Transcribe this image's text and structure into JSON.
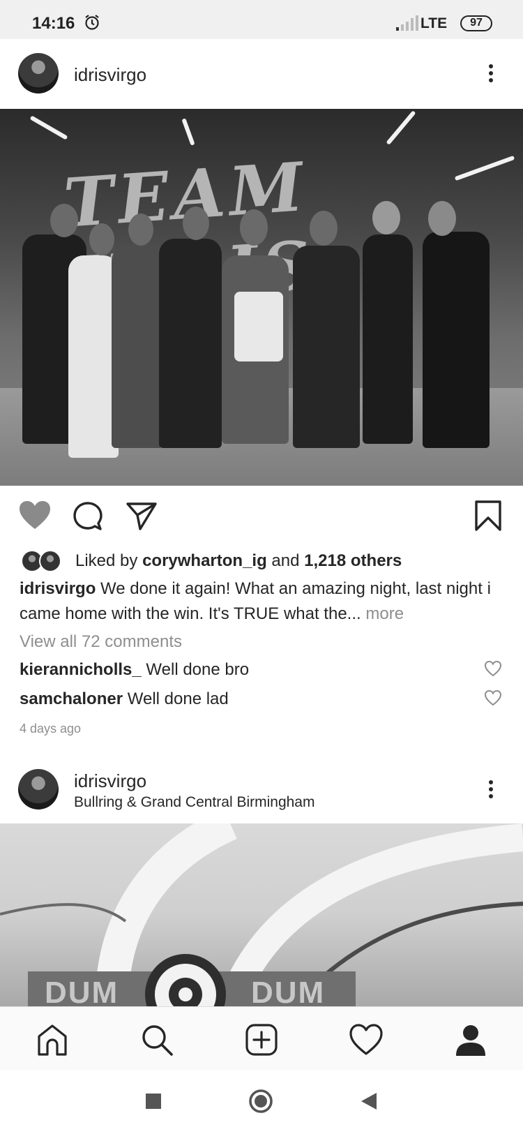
{
  "status_bar": {
    "time": "14:16",
    "network": "LTE",
    "battery": "97",
    "icons": [
      "alarm-icon",
      "signal-icon"
    ]
  },
  "post1": {
    "username": "idrisvirgo",
    "photo_text": "TEAM IDRIS",
    "liked_by_prefix": "Liked by ",
    "liked_by_user": "corywharton_ig",
    "liked_by_middle": " and ",
    "liked_by_count": "1,218 others",
    "caption_user": "idrisvirgo",
    "caption_text": " We done it again! What an amazing night, last night i came home with the win. It's TRUE what the",
    "caption_ellipsis": "...",
    "caption_more": " more",
    "view_comments": "View all 72 comments",
    "comments": [
      {
        "user": "kierannicholls_",
        "text": " Well done bro"
      },
      {
        "user": "samchaloner",
        "text": " Well done lad"
      }
    ],
    "time_ago": "4 days ago"
  },
  "post2": {
    "username": "idrisvirgo",
    "location": "Bullring & Grand Central Birmingham",
    "sign_left": "DUM",
    "sign_right": "DUM"
  },
  "bottom_nav": [
    "home-icon",
    "search-icon",
    "add-post-icon",
    "activity-heart-icon",
    "profile-icon"
  ],
  "android_nav": [
    "recents-button",
    "home-button",
    "back-button"
  ]
}
